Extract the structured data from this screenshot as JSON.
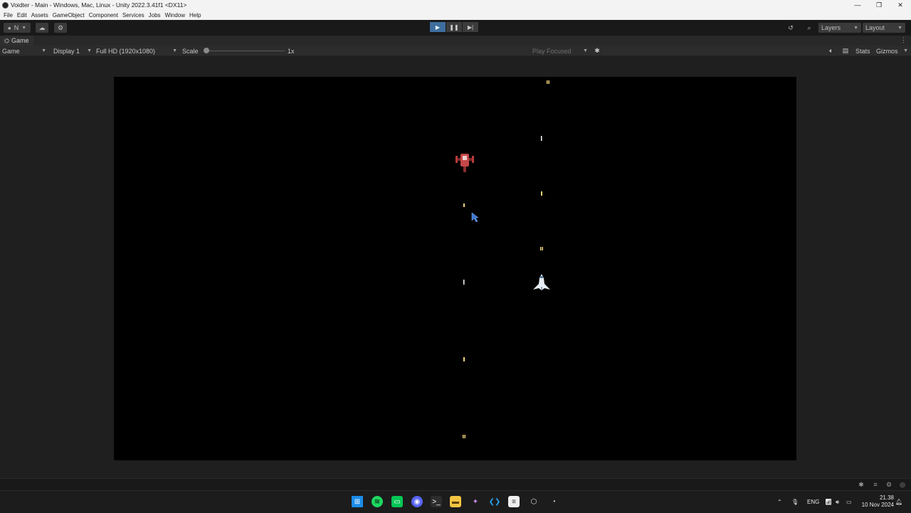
{
  "window": {
    "title": "Voidter - Main - Windows, Mac, Linux - Unity 2022.3.41f1 <DX11>",
    "minimize_glyph": "—",
    "maximize_glyph": "❐",
    "close_glyph": "✕"
  },
  "menu": {
    "items": [
      "File",
      "Edit",
      "Assets",
      "GameObject",
      "Component",
      "Services",
      "Jobs",
      "Window",
      "Help"
    ]
  },
  "toolbar": {
    "account_label": "N",
    "layers_label": "Layers",
    "layout_label": "Layout",
    "play_state": "playing"
  },
  "game_tab": {
    "label": "Game",
    "view_select": "Game",
    "display_select": "Display 1",
    "resolution_select": "Full HD (1920x1080)",
    "scale_label": "Scale",
    "scale_value": "1x",
    "play_mode_select": "Play Focused",
    "stats_label": "Stats",
    "gizmos_label": "Gizmos"
  },
  "scene": {
    "background_color": "#000000",
    "player_color": "#e8eef5",
    "enemy_color": "#b83a3a",
    "bullet_color": "#f2d27a"
  },
  "statusbar": {
    "icons": [
      "bug-icon",
      "layers-icon",
      "debug-icon",
      "check-circle-icon"
    ]
  },
  "taskbar": {
    "apps": [
      "windows-start",
      "spotify",
      "line",
      "discord",
      "terminal",
      "file-explorer",
      "unity-hub-star",
      "vscode",
      "notepad",
      "unity",
      "chrome"
    ],
    "language": "ENG",
    "time": "21.38",
    "date": "10 Nov 2024"
  },
  "colors": {
    "accent_play": "#3f6e9e",
    "editor_bg": "#1e1e1e",
    "toolbar_bg": "#191919"
  }
}
